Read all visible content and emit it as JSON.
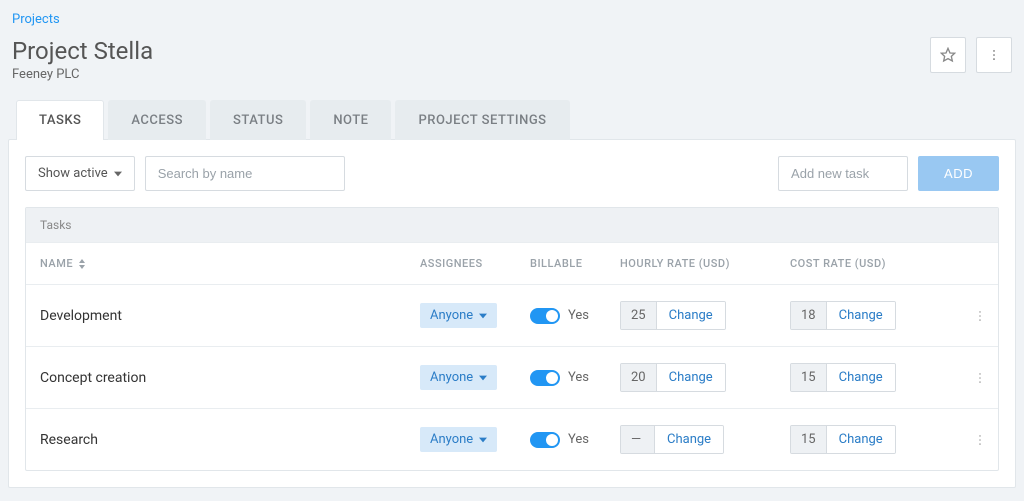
{
  "breadcrumb": "Projects",
  "title": "Project Stella",
  "subtitle": "Feeney PLC",
  "tabs": [
    {
      "label": "TASKS"
    },
    {
      "label": "ACCESS"
    },
    {
      "label": "STATUS"
    },
    {
      "label": "NOTE"
    },
    {
      "label": "PROJECT SETTINGS"
    }
  ],
  "toolbar": {
    "filter_label": "Show active",
    "search_placeholder": "Search by name",
    "add_placeholder": "Add new task",
    "add_button": "ADD"
  },
  "table": {
    "caption": "Tasks",
    "columns": {
      "name": "NAME",
      "assignees": "ASSIGNEES",
      "billable": "BILLABLE",
      "hourly": "HOURLY RATE (USD)",
      "cost": "COST RATE (USD)"
    },
    "assignee_chip": "Anyone",
    "change_label": "Change",
    "billable_yes": "Yes",
    "rows": [
      {
        "name": "Development",
        "hourly": "25",
        "cost": "18"
      },
      {
        "name": "Concept creation",
        "hourly": "20",
        "cost": "15"
      },
      {
        "name": "Research",
        "hourly": "—",
        "cost": "15"
      }
    ]
  }
}
